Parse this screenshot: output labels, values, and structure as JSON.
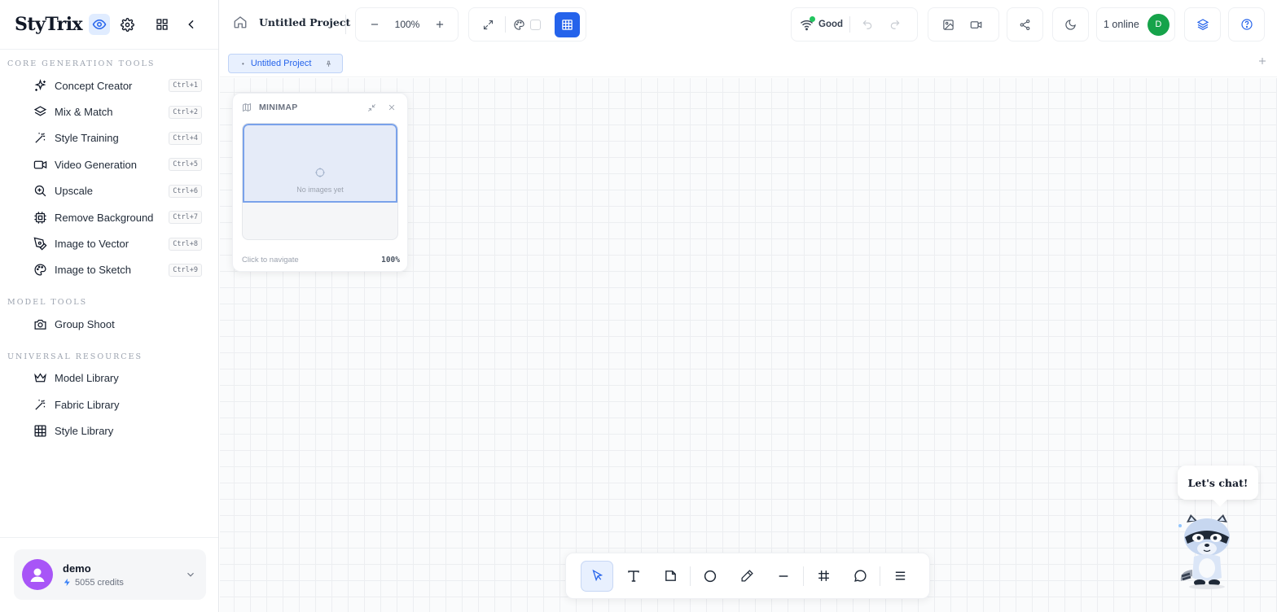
{
  "app": {
    "logo": "StyTrix"
  },
  "sidebar": {
    "sections": [
      {
        "title": "CORE GENERATION TOOLS",
        "items": [
          {
            "label": "Concept Creator",
            "shortcut": "Ctrl+1",
            "icon": "sparkles-icon"
          },
          {
            "label": "Mix & Match",
            "shortcut": "Ctrl+2",
            "icon": "layers-icon"
          },
          {
            "label": "Style Training",
            "shortcut": "Ctrl+4",
            "icon": "magic-wand-icon"
          },
          {
            "label": "Video Generation",
            "shortcut": "Ctrl+5",
            "icon": "video-camera-icon"
          },
          {
            "label": "Upscale",
            "shortcut": "Ctrl+6",
            "icon": "zoom-in-icon"
          },
          {
            "label": "Remove Background",
            "shortcut": "Ctrl+7",
            "icon": "chip-icon"
          },
          {
            "label": "Image to Vector",
            "shortcut": "Ctrl+8",
            "icon": "pen-tool-icon"
          },
          {
            "label": "Image to Sketch",
            "shortcut": "Ctrl+9",
            "icon": "palette-icon"
          }
        ]
      },
      {
        "title": "MODEL TOOLS",
        "items": [
          {
            "label": "Group Shoot",
            "icon": "camera-icon"
          }
        ]
      },
      {
        "title": "UNIVERSAL RESOURCES",
        "items": [
          {
            "label": "Model Library",
            "icon": "crown-icon"
          },
          {
            "label": "Fabric Library",
            "icon": "magic-wand-icon"
          },
          {
            "label": "Style Library",
            "icon": "grid-icon"
          }
        ]
      }
    ],
    "user": {
      "name": "demo",
      "credits": "5055 credits"
    }
  },
  "topbar": {
    "project_title": "Untitled Project",
    "zoom": "100%",
    "connection": "Good",
    "online": "1 online",
    "user_initial": "D"
  },
  "tabs": [
    {
      "label": "Untitled Project"
    }
  ],
  "minimap": {
    "title": "MINIMAP",
    "empty_text": "No images yet",
    "hint": "Click to navigate",
    "zoom": "100%"
  },
  "chat": {
    "bubble": "Let's chat!"
  },
  "colors": {
    "accent": "#2563eb",
    "avatar": "#a855f7",
    "online": "#16a34a"
  }
}
